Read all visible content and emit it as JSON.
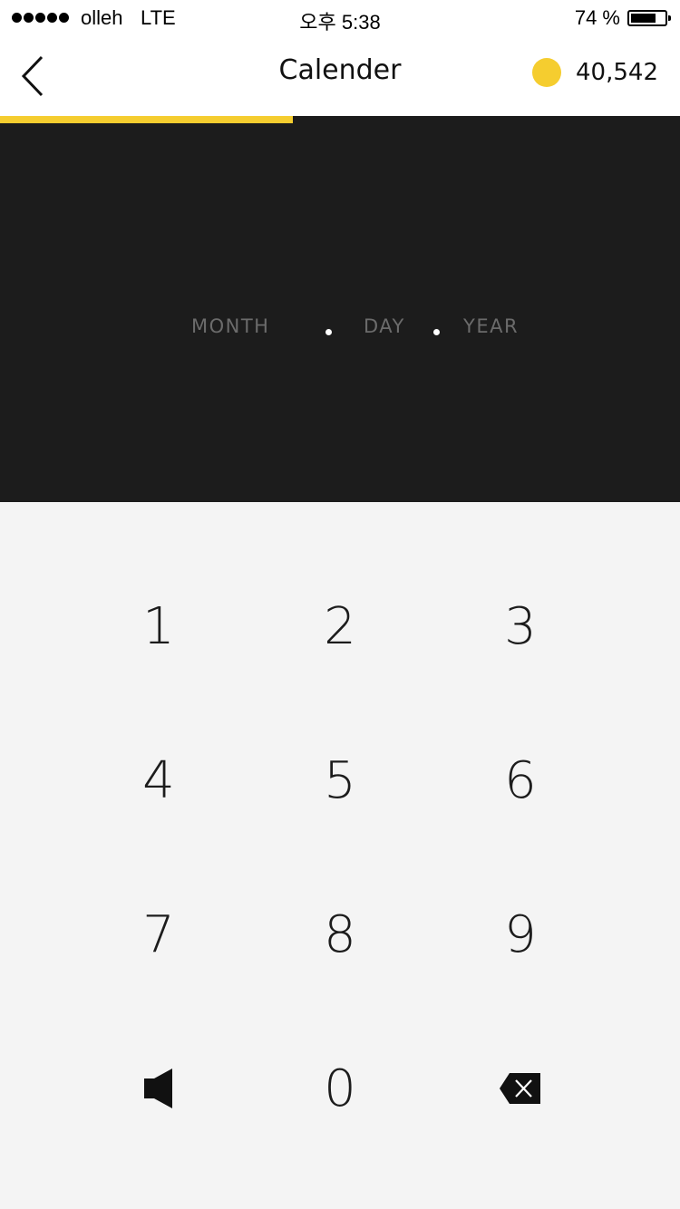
{
  "status_bar": {
    "carrier": "olleh",
    "network": "LTE",
    "time": "오후 5:38",
    "battery": "74 %",
    "battery_level": 0.74
  },
  "header": {
    "back_icon": "chevron-left-icon",
    "title": "Calender",
    "coin_icon": "coin-icon",
    "coin_count": "40,542"
  },
  "progress": {
    "fraction": 0.43
  },
  "date_input": {
    "month_placeholder": "MONTH",
    "day_placeholder": "DAY",
    "year_placeholder": "YEAR"
  },
  "keypad": {
    "keys": [
      "1",
      "2",
      "3",
      "4",
      "5",
      "6",
      "7",
      "8",
      "9"
    ],
    "zero": "0",
    "sound_icon": "speaker-icon",
    "delete_icon": "backspace-icon"
  },
  "colors": {
    "accent": "#f5cd2f",
    "dark_panel": "#1c1c1c",
    "keypad_bg": "#f4f4f4",
    "placeholder_text": "#6b6b6b"
  }
}
